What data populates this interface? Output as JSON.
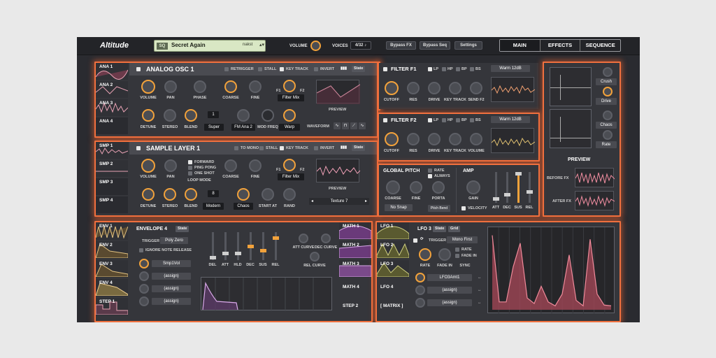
{
  "app": {
    "title": "Altitude"
  },
  "preset": {
    "tag": "SQ",
    "name": "Secret Again",
    "author": "nakst",
    "arrows": "▴▾"
  },
  "top": {
    "volume_label": "VOLUME",
    "voices_label": "VOICES",
    "voices_value": "4/32",
    "note_icon": "♪",
    "bypass_fx": "Bypass FX",
    "bypass_seq": "Bypass Seq",
    "settings": "Settings"
  },
  "tabs": [
    "MAIN",
    "EFFECTS",
    "SEQUENCE"
  ],
  "osc_side": [
    "ANA 1",
    "ANA 2",
    "ANA 3",
    "ANA 4"
  ],
  "smp_side": [
    "SMP 1",
    "SMP 2",
    "SMP 3",
    "SMP 4"
  ],
  "env_side": [
    "ENV 1",
    "ENV 2",
    "ENV 3",
    "ENV 4",
    "STEP 1"
  ],
  "math_side": [
    "MATH 1",
    "MATH 2",
    "MATH 3",
    "MATH 4",
    "STEP 2"
  ],
  "lfo_side": [
    "LFO 1",
    "LFO 2",
    "LFO 3",
    "LFO 4",
    "[ MATRIX ]"
  ],
  "osc": {
    "title": "ANALOG OSC 1",
    "retrigger": "RETRIGGER",
    "stall": "STALL",
    "keytrack": "KEY TRACK",
    "invert": "INVERT",
    "state": "State",
    "k_volume": "VOLUME",
    "k_pan": "PAN",
    "k_phase": "PHASE",
    "k_coarse": "COARSE",
    "k_fine": "FINE",
    "f1": "F1",
    "f2": "F2",
    "filter_mix": "Filter Mix",
    "preview": "PREVIEW",
    "k_detune": "DETUNE",
    "k_stereo": "STEREO",
    "k_blend": "BLEND",
    "unison": "1",
    "super": "Super",
    "fm": "FM Ana 2",
    "mod_freq": "MOD FREQ",
    "warp": "Warp",
    "waveform": "WAVEFORM"
  },
  "smp": {
    "title": "SAMPLE LAYER 1",
    "tomono": "TO MONO",
    "stall": "STALL",
    "keytrack": "KEY TRACK",
    "invert": "INVERT",
    "state": "State",
    "k_volume": "VOLUME",
    "k_pan": "PAN",
    "forward": "FORWARD",
    "pingpong": "PING PONG",
    "oneshot": "ONE SHOT",
    "loop_mode": "LOOP MODE",
    "k_coarse": "COARSE",
    "k_fine": "FINE",
    "f1": "F1",
    "f2": "F2",
    "filter_mix": "Filter Mix",
    "preview": "PREVIEW",
    "k_detune": "DETUNE",
    "k_stereo": "STEREO",
    "k_blend": "BLEND",
    "unison": "8",
    "modern": "Modern",
    "chaos": "Chaos",
    "start_at": "START AT",
    "rand": "RAND",
    "texture": "Texture 7",
    "prev": "◂",
    "next": "▸"
  },
  "ff1": {
    "title": "FILTER F1",
    "lp": "LP",
    "hp": "HP",
    "bp": "BP",
    "bs": "BS",
    "type": "Warm 12dB",
    "k1": "CUTOFF",
    "k2": "RES",
    "k3": "DRIVE",
    "k4": "KEY TRACK",
    "k5": "SEND F2"
  },
  "ff2": {
    "title": "FILTER F2",
    "lp": "LP",
    "hp": "HP",
    "bp": "BP",
    "bs": "BS",
    "type": "Warm 12dB",
    "k1": "CUTOFF",
    "k2": "RES",
    "k3": "DRIVE",
    "k4": "KEY TRACK",
    "k5": "VOLUME"
  },
  "gp": {
    "title": "GLOBAL PITCH",
    "rate": "RATE",
    "always": "ALWAYS",
    "k_coarse": "COARSE",
    "k_fine": "FINE",
    "k_porta": "PORTA",
    "nosnap": "No Snap",
    "pitchbend": "Pitch Bend"
  },
  "amp": {
    "title": "AMP",
    "gain": "GAIN",
    "velocity": "VELOCITY",
    "att": "ATT",
    "dec": "DEC",
    "sus": "SUS",
    "rel": "REL"
  },
  "fxr": {
    "crush": "Crush",
    "drive": "Drive",
    "chaos": "Chaos",
    "rate": "Rate",
    "preview": "PREVIEW",
    "before": "BEFORE FX",
    "after": "AFTER FX"
  },
  "env": {
    "title": "ENVELOPE 4",
    "state": "State",
    "trigger": "TRIGGER",
    "poly": "Poly Zero",
    "ignore": "IGNORE NOTE RELEASE",
    "assign1": "Smp1Vol",
    "assign2": "(assign)",
    "assign3": "(assign)",
    "assign4": "(assign)",
    "del": "DEL",
    "att": "ATT",
    "hld": "HLD",
    "dec": "DEC",
    "sus": "SUS",
    "rel": "REL",
    "attc": "ATT CURVE",
    "decc": "DEC CURVE",
    "relc": "REL CURVE"
  },
  "lfo": {
    "title": "LFO 3",
    "state": "State",
    "grid": "Grid",
    "trigger": "TRIGGER",
    "mono": "Mono First",
    "rate": "RATE",
    "fadein": "FADE IN",
    "sync": "SYNC",
    "k_rate": "RATE",
    "k_fade": "FADE IN",
    "assign1": "LFO3Amt1",
    "assign2": "(assign)",
    "assign3": "(assign)"
  },
  "lfo_wave": [
    0.95,
    0.1,
    0.1,
    0.55,
    0.85,
    0.15,
    0.08,
    0.3,
    0.1,
    0.05,
    0.2,
    0.7,
    0.12,
    0.05,
    0.9,
    0.2,
    0.06,
    0.05
  ],
  "colors": {
    "accent": "#f2a23b",
    "glow": "#f0703e"
  }
}
